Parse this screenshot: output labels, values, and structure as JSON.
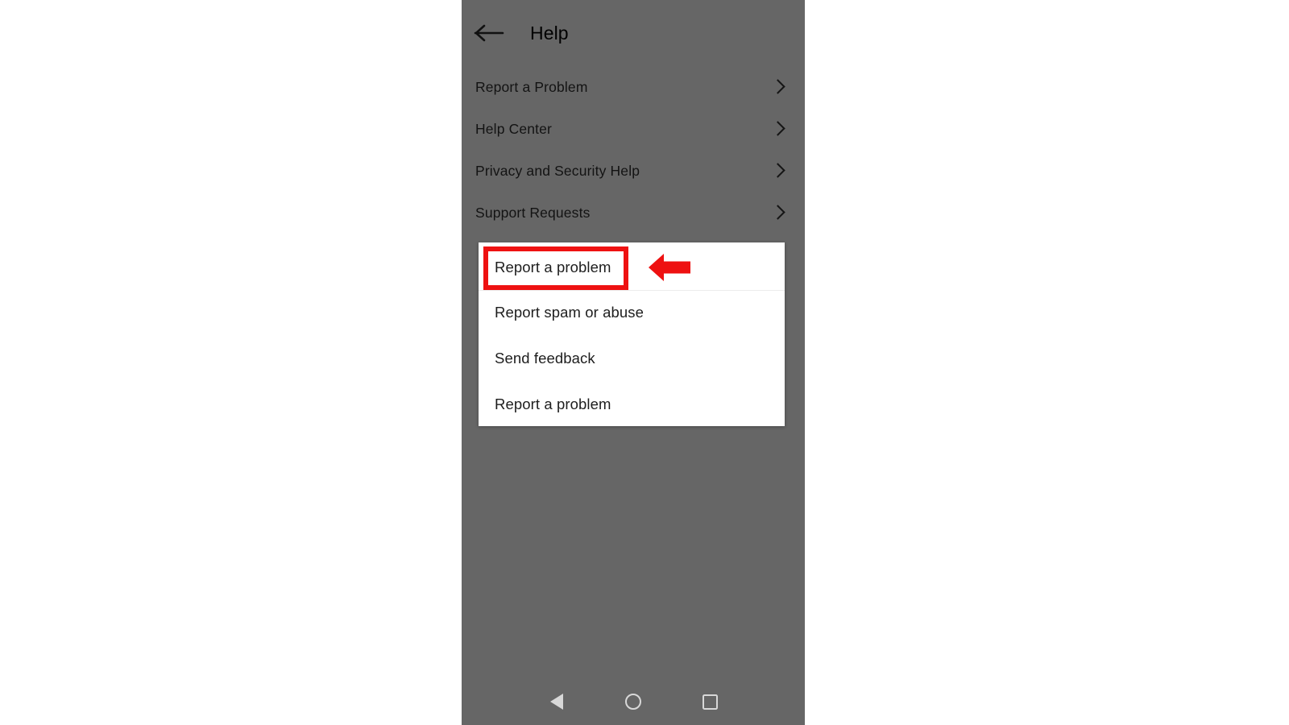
{
  "app": {
    "platform": "android",
    "screen_background": "#666666",
    "page_background": "#ffffff"
  },
  "header": {
    "back_icon": "arrow-left-icon",
    "title": "Help"
  },
  "help_list": {
    "items": [
      {
        "label": "Report a Problem",
        "trailing_icon": "chevron-right-icon"
      },
      {
        "label": "Help Center",
        "trailing_icon": "chevron-right-icon"
      },
      {
        "label": "Privacy and Security Help",
        "trailing_icon": "chevron-right-icon"
      },
      {
        "label": "Support Requests",
        "trailing_icon": "chevron-right-icon"
      }
    ]
  },
  "popup_menu": {
    "items": [
      {
        "label": "Report a problem",
        "highlighted": true
      },
      {
        "label": "Report spam or abuse",
        "highlighted": false
      },
      {
        "label": "Send feedback",
        "highlighted": false
      },
      {
        "label": "Report a problem",
        "highlighted": false
      }
    ]
  },
  "annotations": {
    "highlight_color": "#ee1111",
    "highlight_target": "Report a problem",
    "arrow_icon": "arrow-left-callout-icon",
    "arrow_direction": "left"
  },
  "nav_bar": {
    "buttons": [
      {
        "name": "back",
        "icon": "triangle-left-icon"
      },
      {
        "name": "home",
        "icon": "circle-icon"
      },
      {
        "name": "recents",
        "icon": "square-icon"
      }
    ]
  }
}
